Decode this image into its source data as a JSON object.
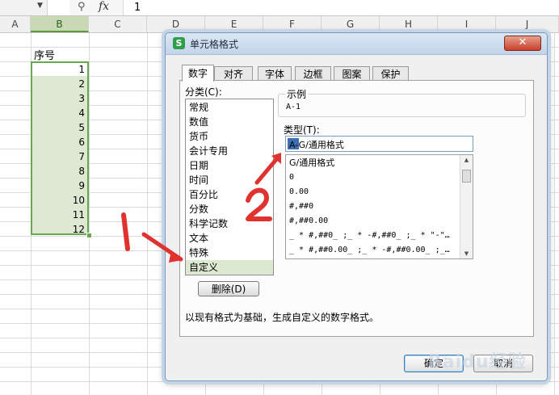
{
  "formula_bar": {
    "dropdown_icon": "chevron-down",
    "zoom_icon": "magnifier",
    "fx_label": "fx",
    "value": "1"
  },
  "columns": [
    "A",
    "B",
    "C",
    "D",
    "E",
    "F",
    "G",
    "H",
    "I",
    "J"
  ],
  "sheet": {
    "header_cell": "序号",
    "values": [
      "1",
      "2",
      "3",
      "4",
      "5",
      "6",
      "7",
      "8",
      "9",
      "10",
      "11",
      "12"
    ]
  },
  "dialog": {
    "title": "单元格格式",
    "app_icon_letter": "S",
    "close_label": "✕",
    "tabs": [
      "数字",
      "对齐",
      "字体",
      "边框",
      "图案",
      "保护"
    ],
    "category_label": "分类(C):",
    "categories": [
      "常规",
      "数值",
      "货币",
      "会计专用",
      "日期",
      "时间",
      "百分比",
      "分数",
      "科学记数",
      "文本",
      "特殊",
      "自定义"
    ],
    "selected_category": "自定义",
    "example_label": "示例",
    "example_value": "A-1",
    "type_label": "类型(T):",
    "type_value": "A-G/通用格式",
    "formats": [
      "G/通用格式",
      "0",
      "0.00",
      "#,##0",
      "#,##0.00",
      "_ * #,##0_ ;_ * -#,##0_ ;_ * \"-\"…",
      "_ * #,##0.00_ ;_ * -#,##0.00_ ;_…"
    ],
    "delete_label": "删除(D)",
    "description": "以现有格式为基础，生成自定义的数字格式。",
    "ok_label": "确定",
    "cancel_label": "取消"
  },
  "annotations": {
    "label_1": "1",
    "label_2": "2",
    "color": "#e0322f"
  },
  "watermark": "Baidu经验",
  "colors": {
    "selection_green": "#6aa84f",
    "selection_fill": "#dfe8d3",
    "dialog_frame": "#c4d5e8"
  }
}
